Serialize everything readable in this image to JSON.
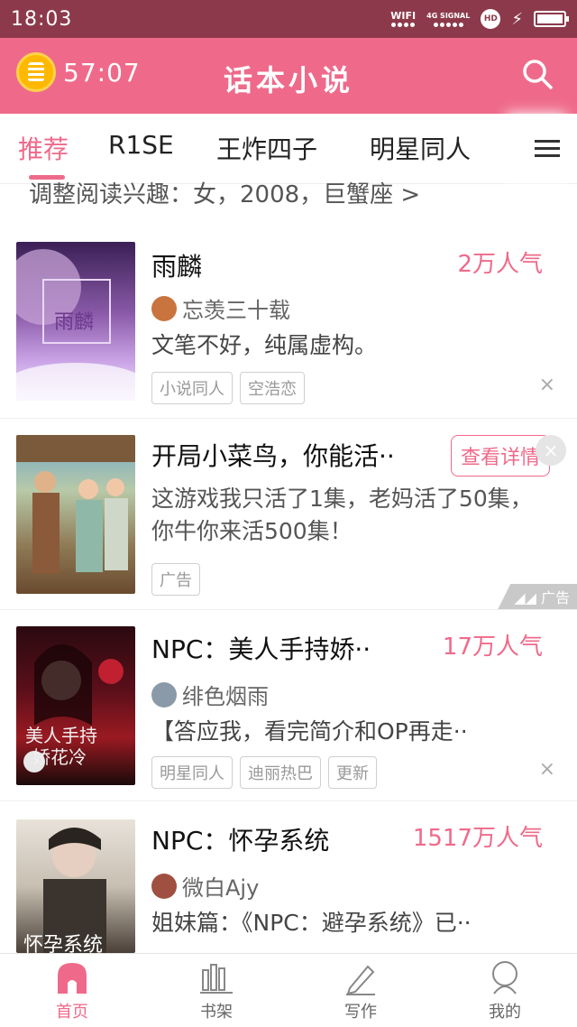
{
  "status_bar": {
    "time": "18:03",
    "wifi": "WIFI",
    "signal": "4G SIGNAL",
    "hd": "HD"
  },
  "header": {
    "timer": "57:07",
    "title": "话本小说",
    "accent": "#ef6a8a"
  },
  "tabs": [
    {
      "label": "推荐",
      "active": true
    },
    {
      "label": "R1SE"
    },
    {
      "label": "王炸四子"
    },
    {
      "label": "明星同人"
    },
    {
      "label": "Ⅰ"
    }
  ],
  "preference": "调整阅读兴趣：女，2008，巨蟹座 >",
  "cards": [
    {
      "title": "雨麟",
      "popularity": "2万人气",
      "author": "忘羡三十载",
      "description": "文笔不好，纯属虚构。",
      "tags": [
        "小说同人",
        "空浩恋"
      ],
      "close": "×"
    },
    {
      "title": "开局小菜鸟，你能活··",
      "cta": "查看详情",
      "description_lines": [
        "这游戏我只活了1集，老妈活了50集，",
        "你牛你来活500集！"
      ],
      "tags": [
        "广告"
      ],
      "ad_label": "广告",
      "close": "×"
    },
    {
      "title": "NPC：美人手持娇··",
      "popularity": "17万人气",
      "author": "绯色烟雨",
      "description": "【答应我，看完简介和OP再走··",
      "tags": [
        "明星同人",
        "迪丽热巴",
        "更新"
      ],
      "close": "×"
    },
    {
      "title": "NPC：怀孕系统",
      "popularity": "1517万人气",
      "author": "微白Ajy",
      "description": "姐妹篇：《NPC：避孕系统》已··"
    }
  ],
  "bottom_nav": [
    {
      "label": "首页",
      "icon": "home-icon",
      "active": true
    },
    {
      "label": "书架",
      "icon": "bookshelf-icon"
    },
    {
      "label": "写作",
      "icon": "pen-icon"
    },
    {
      "label": "我的",
      "icon": "profile-icon"
    }
  ]
}
